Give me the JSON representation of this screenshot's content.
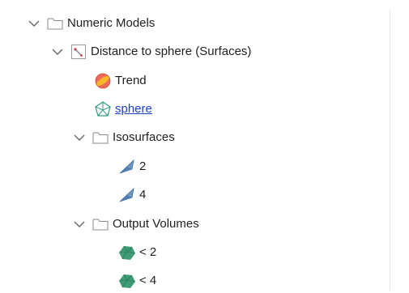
{
  "tree": {
    "numeric_models": {
      "label": "Numeric Models",
      "expanded": true,
      "icon": "folder-icon"
    },
    "distance_model": {
      "label": "Distance to sphere (Surfaces)",
      "expanded": true,
      "icon": "distance-model-icon"
    },
    "trend": {
      "label": "Trend",
      "icon": "trend-icon"
    },
    "sphere": {
      "label": "sphere",
      "icon": "mesh-icon",
      "is_link": true
    },
    "isosurfaces": {
      "label": "Isosurfaces",
      "expanded": true,
      "icon": "folder-icon",
      "items": [
        {
          "label": "2",
          "icon": "isosurface-icon"
        },
        {
          "label": "4",
          "icon": "isosurface-icon"
        }
      ]
    },
    "output_volumes": {
      "label": "Output Volumes",
      "expanded": true,
      "icon": "folder-icon",
      "items": [
        {
          "label": "< 2",
          "icon": "volume-icon"
        },
        {
          "label": "< 4",
          "icon": "volume-icon"
        }
      ]
    }
  },
  "colors": {
    "link": "#1a3fcf",
    "text": "#1f1f1f",
    "isosurface": "#6f97c4",
    "volume": "#3f9b73",
    "trend": "#f06a5a",
    "mesh": "#2e9b84"
  }
}
